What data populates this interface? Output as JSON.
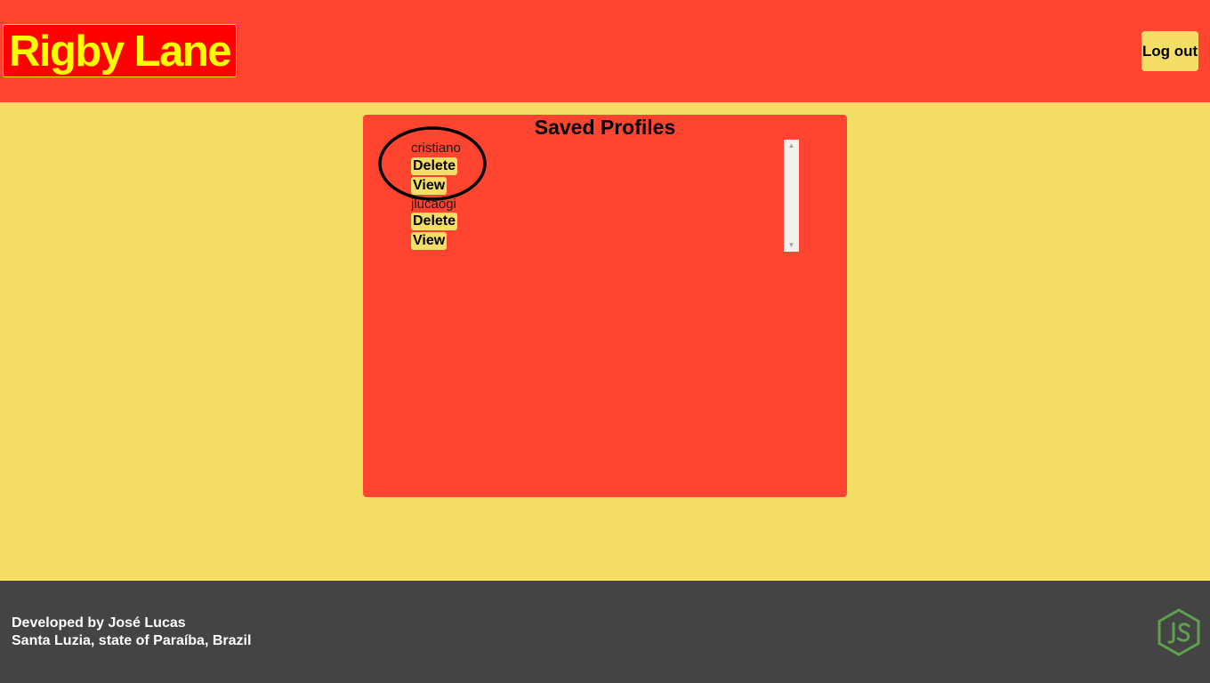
{
  "header": {
    "logo": "Rigby Lane",
    "logout_label": "Log out"
  },
  "panel": {
    "title": "Saved Profiles",
    "profiles": [
      {
        "name": "cristiano",
        "delete_label": "Delete",
        "view_label": "View"
      },
      {
        "name": "jlucaogi",
        "delete_label": "Delete",
        "view_label": "View"
      }
    ]
  },
  "footer": {
    "line1": "Developed by José Lucas",
    "line2": "Santa Luzia, state of Paraíba, Brazil",
    "icon": "nodejs-icon"
  },
  "colors": {
    "header_bg": "#ff4530",
    "page_bg": "#f5de66",
    "logo_bg": "#ff0000",
    "logo_text": "#ffff00",
    "footer_bg": "#444444",
    "node_green": "#5fa04e"
  }
}
